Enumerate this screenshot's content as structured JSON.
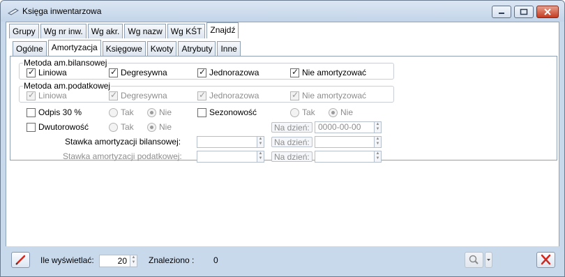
{
  "window": {
    "title": "Księga inwentarzowa"
  },
  "top_tabs": [
    "Grupy",
    "Wg nr inw.",
    "Wg akr.",
    "Wg nazw",
    "Wg KŚT",
    "Znajdź"
  ],
  "sub_tabs": [
    "Ogólne",
    "Amortyzacja",
    "Księgowe",
    "Kwoty",
    "Atrybuty",
    "Inne"
  ],
  "bilansowa": {
    "label": "Metoda am.bilansowej",
    "options": [
      {
        "label": "Liniowa",
        "checked": true
      },
      {
        "label": "Degresywna",
        "checked": true
      },
      {
        "label": "Jednorazowa",
        "checked": true
      },
      {
        "label": "Nie amortyzować",
        "checked": true
      }
    ]
  },
  "podatkowa": {
    "label": "Metoda am.podatkowej",
    "options": [
      {
        "label": "Liniowa",
        "checked": true
      },
      {
        "label": "Degresywna",
        "checked": true
      },
      {
        "label": "Jednorazowa",
        "checked": true
      },
      {
        "label": "Nie amortyzować",
        "checked": true
      }
    ]
  },
  "odpis": {
    "label": "Odpis 30 %",
    "checked": false,
    "tak": "Tak",
    "nie": "Nie"
  },
  "sezonowosc": {
    "label": "Sezonowość",
    "checked": false,
    "tak": "Tak",
    "nie": "Nie"
  },
  "dwutorowosc": {
    "label": "Dwutorowość",
    "checked": false,
    "tak": "Tak",
    "nie": "Nie"
  },
  "na_dzien_label": "Na dzień:",
  "na_dzien_value": "0000-00-00",
  "stawka_bil_label": "Stawka amortyzacji bilansowej:",
  "stawka_pod_label": "Stawka amortyzacji podatkowej:",
  "footer": {
    "ile_label": "Ile wyświetlać:",
    "ile_value": "20",
    "znaleziono_label": "Znaleziono :",
    "znaleziono_value": "0"
  }
}
